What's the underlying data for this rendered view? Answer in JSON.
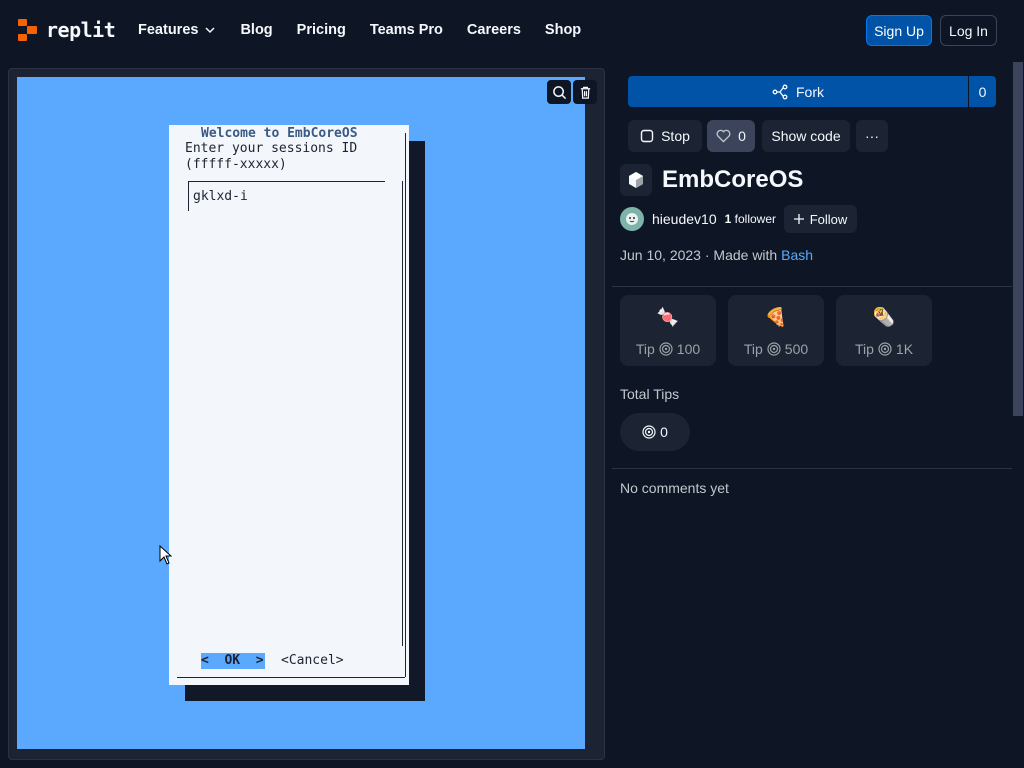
{
  "nav": {
    "brand": "replit",
    "links": [
      "Features",
      "Blog",
      "Pricing",
      "Teams Pro",
      "Careers",
      "Shop"
    ],
    "signup": "Sign Up",
    "login": "Log In"
  },
  "terminal": {
    "dialog_title": "Welcome to EmbCoreOS",
    "prompt_line1": "Enter your sessions ID",
    "prompt_line2": "(fffff-xxxxx)",
    "input_value": "gklxd-i",
    "ok_label": "<  OK  >",
    "cancel_label": "<Cancel>"
  },
  "repl": {
    "fork_label": "Fork",
    "fork_count": "0",
    "stop_label": "Stop",
    "like_count": "0",
    "show_code_label": "Show code",
    "more_label": "···",
    "title": "EmbCoreOS",
    "owner": "hieudev10",
    "followers_count": "1",
    "followers_label": "follower",
    "follow_label": "Follow",
    "date": "Jun 10, 2023",
    "made_with_label": "· Made with",
    "language": "Bash"
  },
  "tips": [
    {
      "emoji": "🍬",
      "label": "Tip",
      "amount": "100"
    },
    {
      "emoji": "🍕",
      "label": "Tip",
      "amount": "500"
    },
    {
      "emoji": "🌯",
      "label": "Tip",
      "amount": "1K"
    }
  ],
  "total_tips": {
    "label": "Total Tips",
    "value": "0"
  },
  "comments": {
    "empty_text": "No comments yet"
  },
  "colors": {
    "accent": "#0053a6",
    "brand_orange": "#f26207",
    "terminal_bg": "#5aa9ff",
    "page_bg": "#0e1525"
  }
}
